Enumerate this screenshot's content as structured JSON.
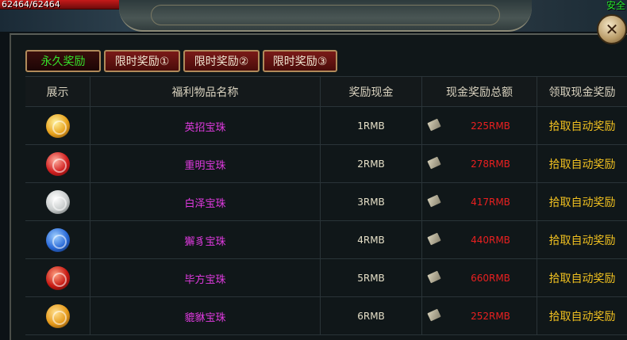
{
  "hud": {
    "hp_text": "62464/62464",
    "safe_zone": "安全"
  },
  "tabs": [
    {
      "label": "永久奖励",
      "active": true
    },
    {
      "label": "限时奖励①",
      "active": false
    },
    {
      "label": "限时奖励②",
      "active": false
    },
    {
      "label": "限时奖励③",
      "active": false
    }
  ],
  "table": {
    "headers": [
      "展示",
      "福利物品名称",
      "奖励现金",
      "现金奖励总额",
      "领取现金奖励"
    ],
    "rows": [
      {
        "icon": "gold-orb-icon",
        "color": "#e8a21c",
        "name": "英招宝珠",
        "reward": "1RMB",
        "total": "225RMB",
        "action": "拾取自动奖励"
      },
      {
        "icon": "red-orb-icon",
        "color": "#d22020",
        "name": "重明宝珠",
        "reward": "2RMB",
        "total": "278RMB",
        "action": "拾取自动奖励"
      },
      {
        "icon": "silver-orb-icon",
        "color": "#c8cccc",
        "name": "白泽宝珠",
        "reward": "3RMB",
        "total": "417RMB",
        "action": "拾取自动奖励"
      },
      {
        "icon": "blue-orb-icon",
        "color": "#2a6ad8",
        "name": "獬豸宝珠",
        "reward": "4RMB",
        "total": "440RMB",
        "action": "拾取自动奖励"
      },
      {
        "icon": "crimson-orb-icon",
        "color": "#c81a14",
        "name": "毕方宝珠",
        "reward": "5RMB",
        "total": "660RMB",
        "action": "拾取自动奖励"
      },
      {
        "icon": "amber-orb-icon",
        "color": "#e69a1a",
        "name": "貔貅宝珠",
        "reward": "6RMB",
        "total": "252RMB",
        "action": "拾取自动奖励"
      }
    ]
  }
}
